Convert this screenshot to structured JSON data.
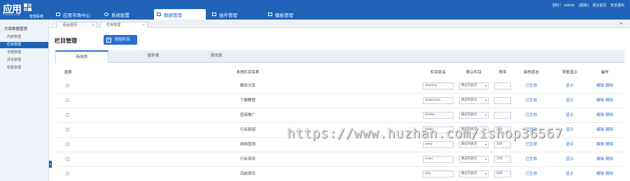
{
  "header": {
    "logo_main": "应用",
    "logo_sub": "YYUIAN.COM",
    "logo_system": "管理系统",
    "nav": [
      {
        "label": "应用市场中心",
        "icon": "monitor-icon"
      },
      {
        "label": "系统配置",
        "icon": "gear-icon"
      },
      {
        "label": "数据管理",
        "icon": "list-icon"
      },
      {
        "label": "插件管理",
        "icon": "puzzle-icon"
      },
      {
        "label": "模板管理",
        "icon": "layout-icon"
      }
    ],
    "user_greeting": "您好！ admin",
    "user_role": "[超级]",
    "view_site": "前台首页",
    "logout": "安全退出"
  },
  "sidebar": {
    "title": "文章数据管理",
    "items": [
      {
        "label": "内容管理"
      },
      {
        "label": "栏目管理"
      },
      {
        "label": "专题管理"
      },
      {
        "label": "评论管理"
      },
      {
        "label": "标签管理"
      }
    ]
  },
  "page_tabs": [
    {
      "label": "后台首页"
    },
    {
      "label": "栏目管理"
    }
  ],
  "main": {
    "title": "栏目管理",
    "add_button": "添加栏目",
    "category_tabs": [
      {
        "label": "新闻类"
      },
      {
        "label": "软件类"
      },
      {
        "label": "资讯类"
      }
    ],
    "table": {
      "headers": [
        "选择",
        "本地栏目名称",
        "栏目别名",
        "默认栏目",
        "排序",
        "审核状态",
        "导航显示",
        "操作"
      ],
      "rows": [
        {
          "name": "精彩分享",
          "alias": "sharing",
          "default": "静态列表页",
          "sort": "",
          "status": "已生效",
          "nav": "显示",
          "edit": "编辑",
          "delete": "删除"
        },
        {
          "name": "下载教程",
          "alias": "download",
          "default": "静态列表页",
          "sort": "",
          "status": "已生效",
          "nav": "显示",
          "edit": "编辑",
          "delete": "删除"
        },
        {
          "name": "招商推广",
          "alias": "bidder",
          "default": "静态列表页",
          "sort": "",
          "status": "已生效",
          "nav": "显示",
          "edit": "编辑",
          "delete": "删除"
        },
        {
          "name": "行业新闻",
          "alias": "news",
          "default": "静态列表页",
          "sort": "100",
          "status": "已生效",
          "nav": "显示",
          "edit": "编辑",
          "delete": "删除"
        },
        {
          "name": "网络营销",
          "alias": "www",
          "default": "静态列表页",
          "sort": "100",
          "status": "已生效",
          "nav": "显示",
          "edit": "编辑",
          "delete": "删除"
        },
        {
          "name": "行业资讯",
          "alias": "news",
          "default": "静态列表页",
          "sort": "100",
          "status": "已生效",
          "nav": "显示",
          "edit": "编辑",
          "delete": "删除"
        },
        {
          "name": "目前资讯",
          "alias": "zxq",
          "default": "静态列表页",
          "sort": "100",
          "status": "已生效",
          "nav": "显示",
          "edit": "编辑",
          "delete": "删除"
        }
      ]
    }
  },
  "watermark": "https://www.huzhan.com/ishop36567",
  "colors": {
    "brand": "#1f62b8",
    "link": "#2a6fd0"
  }
}
